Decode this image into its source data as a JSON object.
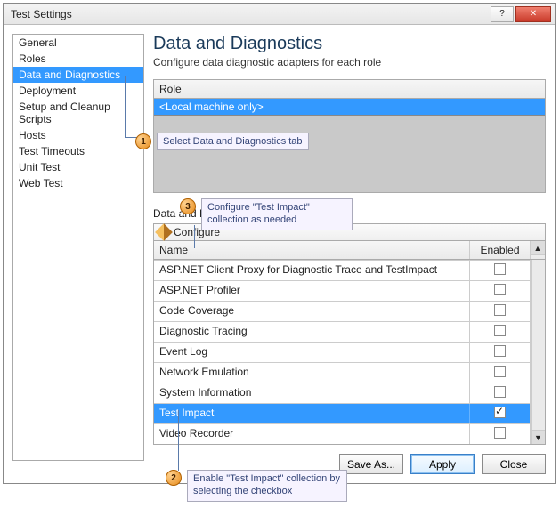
{
  "window": {
    "title": "Test Settings"
  },
  "sidebar": {
    "items": [
      {
        "label": "General"
      },
      {
        "label": "Roles"
      },
      {
        "label": "Data and Diagnostics",
        "selected": true
      },
      {
        "label": "Deployment"
      },
      {
        "label": "Setup and Cleanup Scripts"
      },
      {
        "label": "Hosts"
      },
      {
        "label": "Test Timeouts"
      },
      {
        "label": "Unit Test"
      },
      {
        "label": "Web Test"
      }
    ]
  },
  "page": {
    "title": "Data and Diagnostics",
    "subtitle": "Configure data diagnostic adapters for each role"
  },
  "role": {
    "header": "Role",
    "selected": "<Local machine only>"
  },
  "dd": {
    "section_label": "Data and Diagnostics for selected role:",
    "configure_label": "Configure"
  },
  "grid": {
    "columns": {
      "name": "Name",
      "enabled": "Enabled"
    },
    "rows": [
      {
        "name": "ASP.NET Client Proxy for Diagnostic Trace and TestImpact",
        "enabled": false
      },
      {
        "name": "ASP.NET Profiler",
        "enabled": false
      },
      {
        "name": "Code Coverage",
        "enabled": false
      },
      {
        "name": "Diagnostic Tracing",
        "enabled": false
      },
      {
        "name": "Event Log",
        "enabled": false
      },
      {
        "name": "Network Emulation",
        "enabled": false
      },
      {
        "name": "System Information",
        "enabled": false
      },
      {
        "name": "Test Impact",
        "enabled": true,
        "selected": true
      },
      {
        "name": "Video Recorder",
        "enabled": false
      }
    ]
  },
  "buttons": {
    "save_as": "Save As...",
    "apply": "Apply",
    "close": "Close"
  },
  "callouts": {
    "1": "Select Data and Diagnostics tab",
    "2": "Enable \"Test Impact\" collection by selecting the checkbox",
    "3": "Configure \"Test Impact\" collection as needed"
  }
}
